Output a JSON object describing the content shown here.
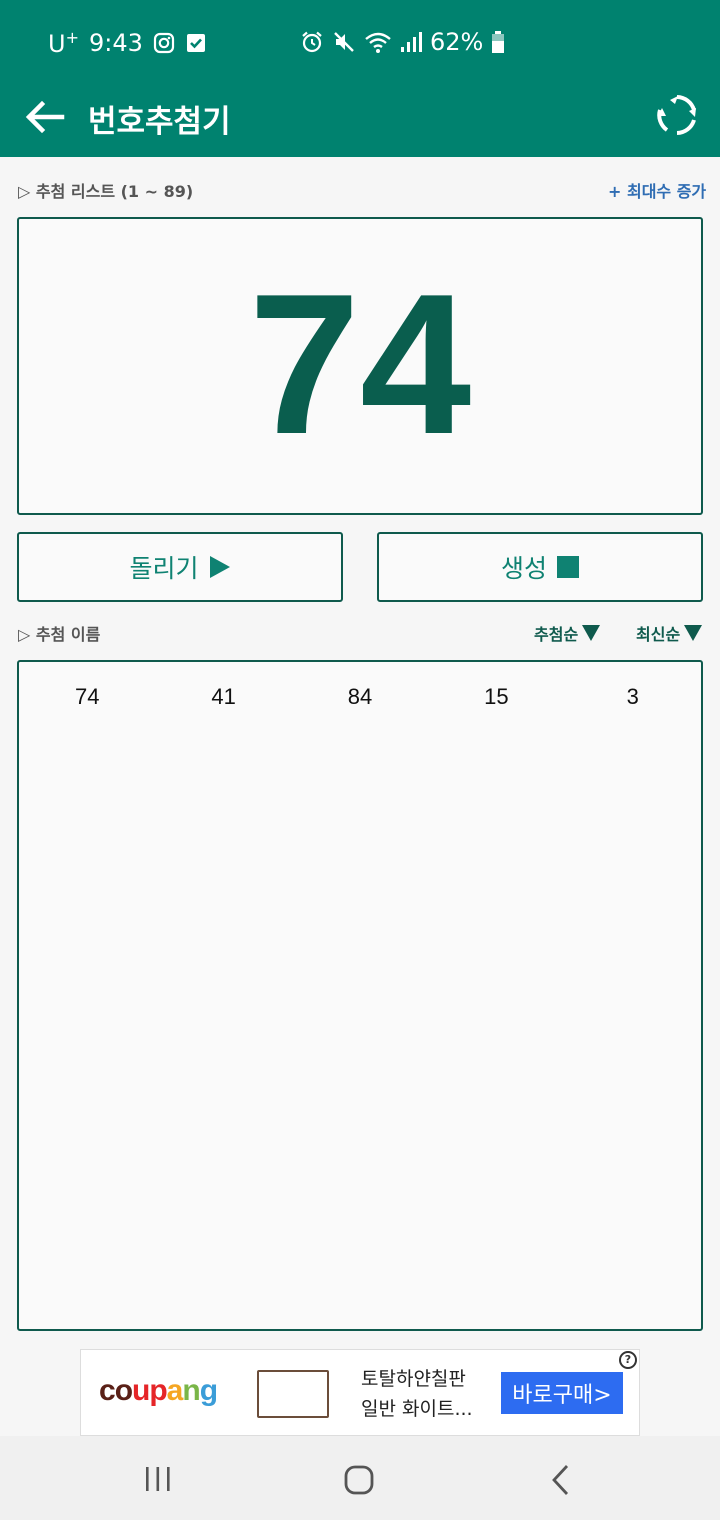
{
  "status_bar": {
    "carrier": "U",
    "carrier_sup": "+",
    "time": "9:43",
    "battery": "62%",
    "icons": [
      "instagram-icon",
      "checkbox-icon",
      "alarm-icon",
      "mute-icon",
      "wifi-icon",
      "signal-icon",
      "battery-icon"
    ]
  },
  "app_bar": {
    "title": "번호추첨기",
    "back_icon": "back-arrow-icon",
    "refresh_icon": "refresh-icon"
  },
  "draw_list": {
    "label": "▷ 추첨 리스트 (1 ~ 89)",
    "increase_link": "+ 최대수 증가"
  },
  "current_number": "74",
  "buttons": {
    "spin": "돌리기",
    "generate": "생성"
  },
  "results_section": {
    "label": "▷ 추첨 이름",
    "sort_draw_order": "추첨순",
    "sort_latest": "최신순"
  },
  "results": [
    "74",
    "41",
    "84",
    "15",
    "3"
  ],
  "ad": {
    "brand": [
      "c",
      "o",
      "u",
      "p",
      "a",
      "n",
      "g"
    ],
    "line1": "토탈하얀칠판",
    "line2": "일반 화이트...",
    "cta": "바로구매>",
    "info": "?"
  },
  "colors": {
    "primary": "#00826f",
    "dark_green": "#0a5e4e",
    "link_blue": "#2f6db3",
    "cta_blue": "#2d6cf1"
  }
}
